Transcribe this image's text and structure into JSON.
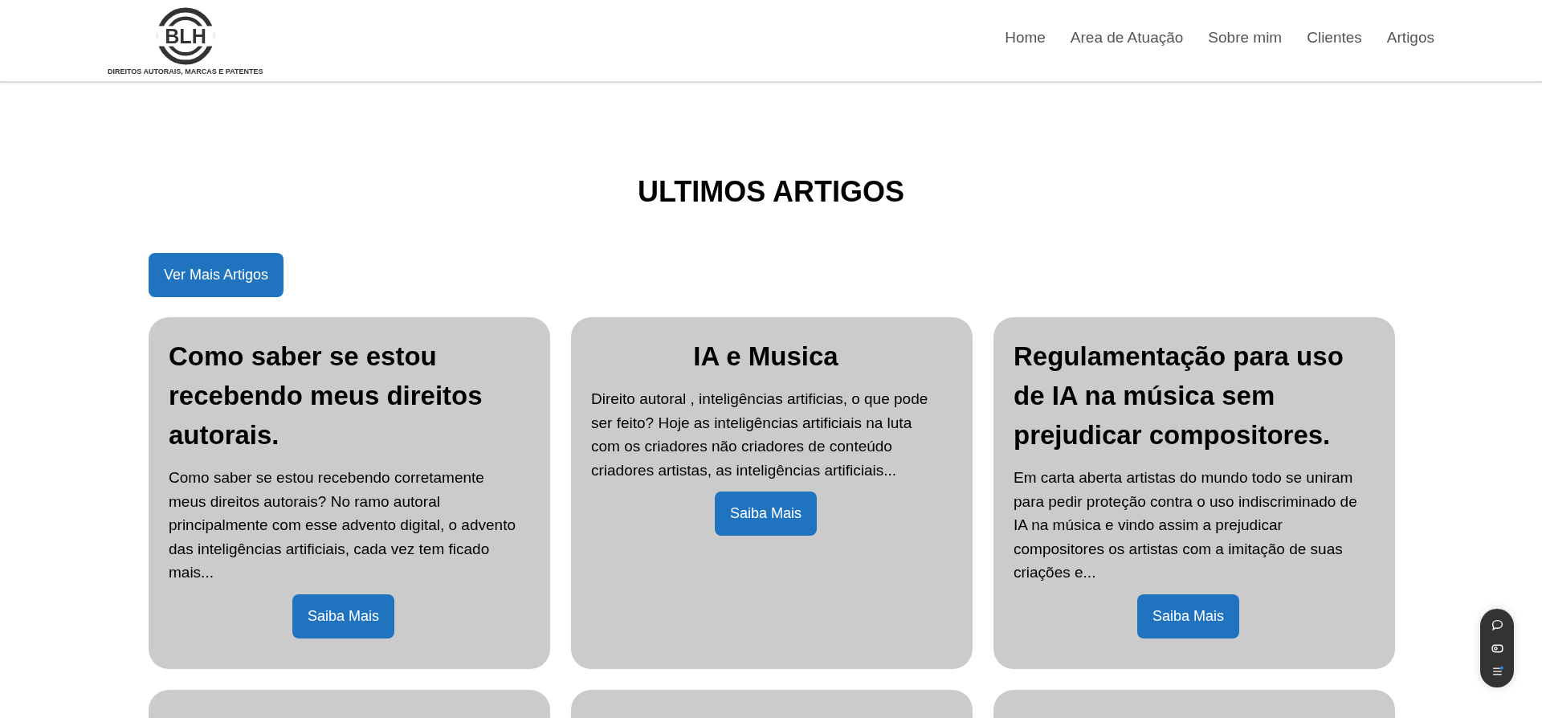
{
  "logo": {
    "text": "BLH",
    "tagline": "DIREITOS AUTORAIS, MARCAS E PATENTES"
  },
  "nav": [
    {
      "label": "Home"
    },
    {
      "label": "Area de Atuação"
    },
    {
      "label": "Sobre mim"
    },
    {
      "label": "Clientes"
    },
    {
      "label": "Artigos"
    }
  ],
  "section": {
    "title": "ULTIMOS ARTIGOS",
    "more_button": "Ver Mais Artigos"
  },
  "articles": [
    {
      "title": "Como saber se estou recebendo meus direitos autorais.",
      "centered": false,
      "excerpt": "Como saber se estou recebendo corretamente meus direitos autorais? No ramo autoral principalmente com esse advento digital, o advento das inteligências artificiais, cada vez tem ficado mais...",
      "button": "Saiba Mais"
    },
    {
      "title": "IA e Musica",
      "centered": true,
      "excerpt": "Direito autoral , inteligências artificias, o que pode ser feito? Hoje as inteligências artificiais na luta com os criadores não criadores de conteúdo criadores artistas, as inteligências artificiais...",
      "button": "Saiba Mais"
    },
    {
      "title": "Regulamentação para uso de IA na música sem prejudicar compositores.",
      "centered": false,
      "excerpt": "Em carta aberta artistas do mundo todo se uniram para pedir proteção contra o uso indiscriminado de IA na música e vindo assim a prejudicar compositores os artistas com a imitação de suas criações e...",
      "button": "Saiba Mais"
    }
  ]
}
